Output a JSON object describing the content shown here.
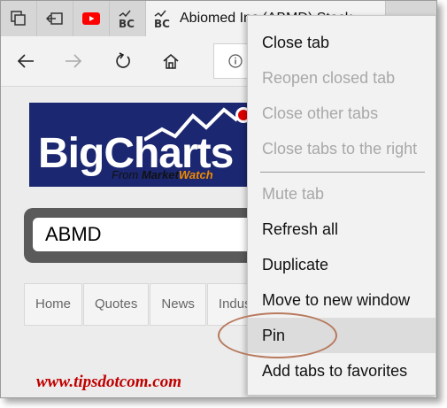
{
  "tabs": {
    "active_title": "Abiomed Inc (ABMD) Stock"
  },
  "page": {
    "logo_text": "BigCharts",
    "logo_sub_from": "From ",
    "logo_sub_brand1": "Market",
    "logo_sub_brand2": "Watch",
    "search_value": "ABMD",
    "nav_links": [
      "Home",
      "Quotes",
      "News",
      "Indus"
    ]
  },
  "context_menu": {
    "items": [
      {
        "label": "Close tab",
        "enabled": true
      },
      {
        "label": "Reopen closed tab",
        "enabled": false
      },
      {
        "label": "Close other tabs",
        "enabled": false
      },
      {
        "label": "Close tabs to the right",
        "enabled": false
      },
      {
        "label": "Mute tab",
        "enabled": false
      },
      {
        "label": "Refresh all",
        "enabled": true
      },
      {
        "label": "Duplicate",
        "enabled": true
      },
      {
        "label": "Move to new window",
        "enabled": true
      },
      {
        "label": "Pin",
        "enabled": true,
        "highlighted": true
      },
      {
        "label": "Add tabs to favorites",
        "enabled": true
      }
    ]
  },
  "watermark": "www.tipsdotcom.com",
  "colors": {
    "youtube_red": "#ff0000",
    "logo_blue": "#1b2770",
    "watermark_red": "#c00000",
    "annotation_ring": "#b87a5e"
  }
}
